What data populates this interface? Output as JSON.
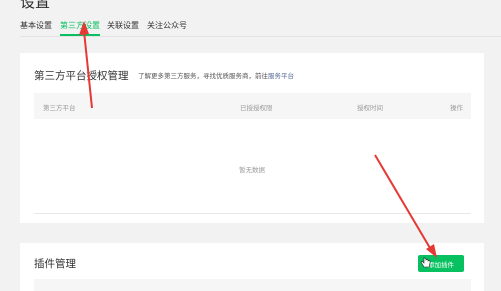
{
  "page": {
    "title": "设置"
  },
  "tabs": [
    {
      "label": "基本设置"
    },
    {
      "label": "第三方设置",
      "active": true
    },
    {
      "label": "关联设置"
    },
    {
      "label": "关注公众号"
    }
  ],
  "auth_card": {
    "title": "第三方平台授权管理",
    "desc_prefix": "了解更多第三方服务，寻找优质服务商，前往",
    "desc_link": "服务平台",
    "columns": [
      "第三方平台",
      "已授授权限",
      "授权时间",
      "操作"
    ],
    "empty_text": "暂无数据"
  },
  "plugin_card": {
    "title": "插件管理",
    "add_button": "添加插件"
  },
  "colors": {
    "accent": "#07c160",
    "link": "#576b95",
    "annotation": "#e53935"
  }
}
